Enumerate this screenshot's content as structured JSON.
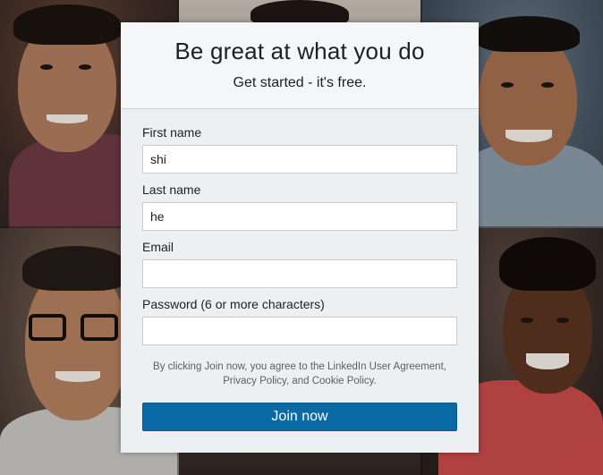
{
  "signup": {
    "title": "Be great at what you do",
    "subtitle": "Get started - it's free.",
    "fields": {
      "first_name": {
        "label": "First name",
        "value": "shi"
      },
      "last_name": {
        "label": "Last name",
        "value": "he"
      },
      "email": {
        "label": "Email",
        "value": ""
      },
      "password": {
        "label": "Password (6 or more characters)",
        "value": ""
      }
    },
    "legal_text": "By clicking Join now, you agree to the LinkedIn User Agreement, Privacy Policy, and Cookie Policy.",
    "join_button_label": "Join now"
  },
  "colors": {
    "primary_button": "#0a6aa6",
    "card_background": "#edf0f3",
    "header_background": "#f5f6f7"
  }
}
